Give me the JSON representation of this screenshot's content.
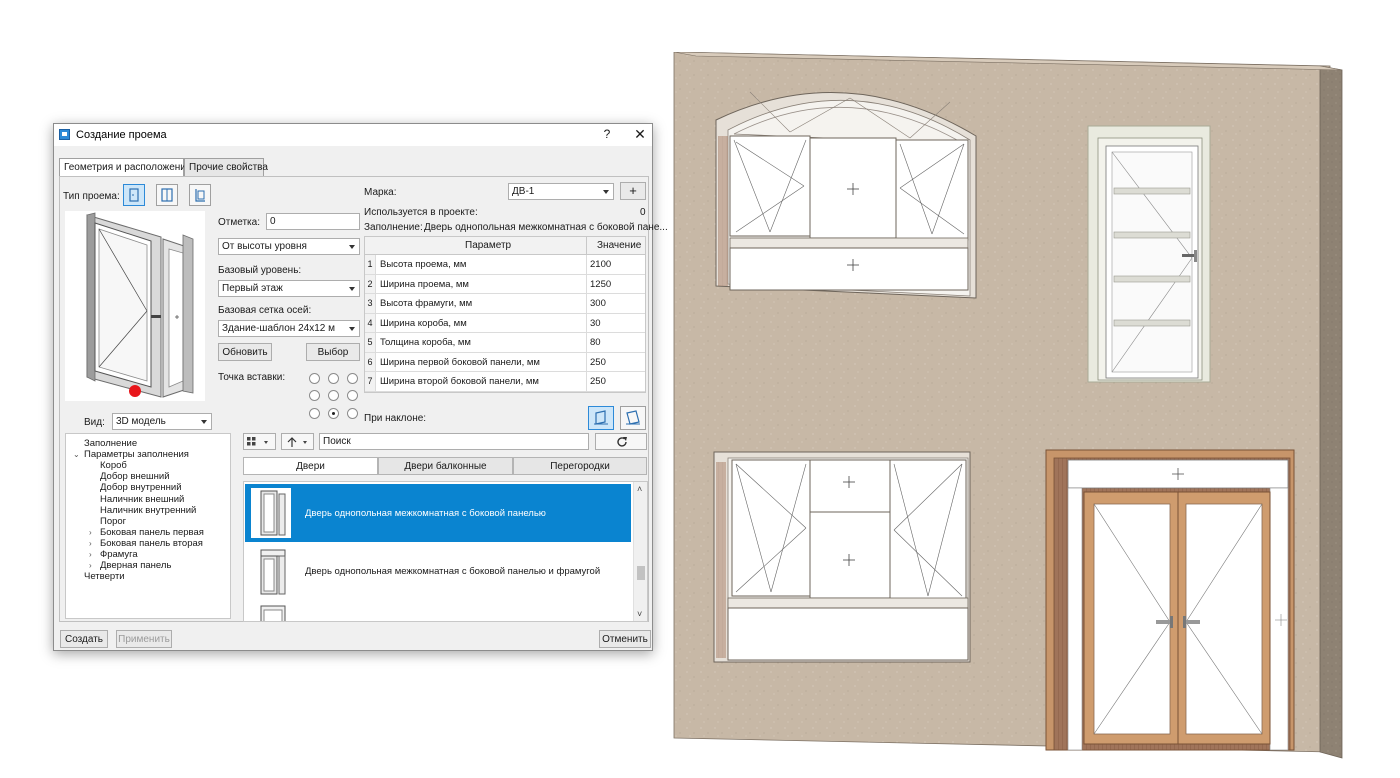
{
  "dialog": {
    "title": "Создание проема",
    "help": "?",
    "close": "✕",
    "tabs": [
      "Геометрия и расположение",
      "Прочие свойства"
    ],
    "opening_type_label": "Тип проема:",
    "elevation_label": "Отметка:",
    "elevation_value": "0",
    "height_mode": "От высоты уровня",
    "base_level_label": "Базовый уровень:",
    "base_level_value": "Первый этаж",
    "grid_label": "Базовая сетка осей:",
    "grid_value": "Здание-шаблон 24х12 м",
    "update_button": "Обновить",
    "select_button": "Выбор",
    "insert_point_label": "Точка вставки:",
    "view_label": "Вид:",
    "view_value": "3D модель",
    "mark_label": "Марка:",
    "mark_value": "ДВ-1",
    "add_label": "+",
    "used_label": "Используется в проекте:",
    "used_value": "0",
    "fill_label": "Заполнение:",
    "fill_value": "Дверь однопольная межкомнатная с боковой пане...",
    "tilt_label": "При наклоне:",
    "create_button": "Создать",
    "apply_button": "Применить",
    "cancel_button": "Отменить"
  },
  "params_table": {
    "headers": [
      "Параметр",
      "Значение"
    ],
    "rows": [
      {
        "n": "1",
        "name": "Высота проема, мм",
        "value": "2100"
      },
      {
        "n": "2",
        "name": "Ширина проема, мм",
        "value": "1250"
      },
      {
        "n": "3",
        "name": "Высота фрамуги, мм",
        "value": "300"
      },
      {
        "n": "4",
        "name": "Ширина короба, мм",
        "value": "30"
      },
      {
        "n": "5",
        "name": "Толщина короба, мм",
        "value": "80"
      },
      {
        "n": "6",
        "name": "Ширина первой боковой панели, мм",
        "value": "250"
      },
      {
        "n": "7",
        "name": "Ширина второй боковой панели, мм",
        "value": "250"
      }
    ]
  },
  "tree": {
    "items": [
      {
        "label": "Заполнение",
        "level": 0,
        "arrow": ""
      },
      {
        "label": "Параметры заполнения",
        "level": 1,
        "arrow": "⌄"
      },
      {
        "label": "Короб",
        "level": 2,
        "arrow": ""
      },
      {
        "label": "Добор внешний",
        "level": 2,
        "arrow": ""
      },
      {
        "label": "Добор внутренний",
        "level": 2,
        "arrow": ""
      },
      {
        "label": "Наличник внешний",
        "level": 2,
        "arrow": ""
      },
      {
        "label": "Наличник внутренний",
        "level": 2,
        "arrow": ""
      },
      {
        "label": "Порог",
        "level": 2,
        "arrow": ""
      },
      {
        "label": "Боковая панель первая",
        "level": 2,
        "arrow": "›"
      },
      {
        "label": "Боковая панель вторая",
        "level": 2,
        "arrow": "›"
      },
      {
        "label": "Фрамуга",
        "level": 2,
        "arrow": "›"
      },
      {
        "label": "Дверная панель",
        "level": 2,
        "arrow": "›"
      },
      {
        "label": "Четверти",
        "level": 1,
        "arrow": ""
      }
    ]
  },
  "library": {
    "search_placeholder": "Поиск",
    "tabs": [
      "Двери",
      "Двери балконные",
      "Перегородки"
    ],
    "items": [
      {
        "name": "Дверь однопольная межкомнатная с боковой панелью",
        "selected": true
      },
      {
        "name": "Дверь однопольная межкомнатная с боковой панелью и фрамугой",
        "selected": false
      }
    ]
  },
  "icons": {
    "opening_types": [
      "door-opening-icon",
      "window-opening-icon",
      "niche-opening-icon"
    ],
    "tilt_modes": [
      "vertical-tilt-icon",
      "slanted-tilt-icon"
    ]
  },
  "colors": {
    "accent": "#0a84d0",
    "wall": "#c7b8a6",
    "wall_side": "#8e8273",
    "door_wood": "#c7956a",
    "insert_point": "#e8161b"
  }
}
